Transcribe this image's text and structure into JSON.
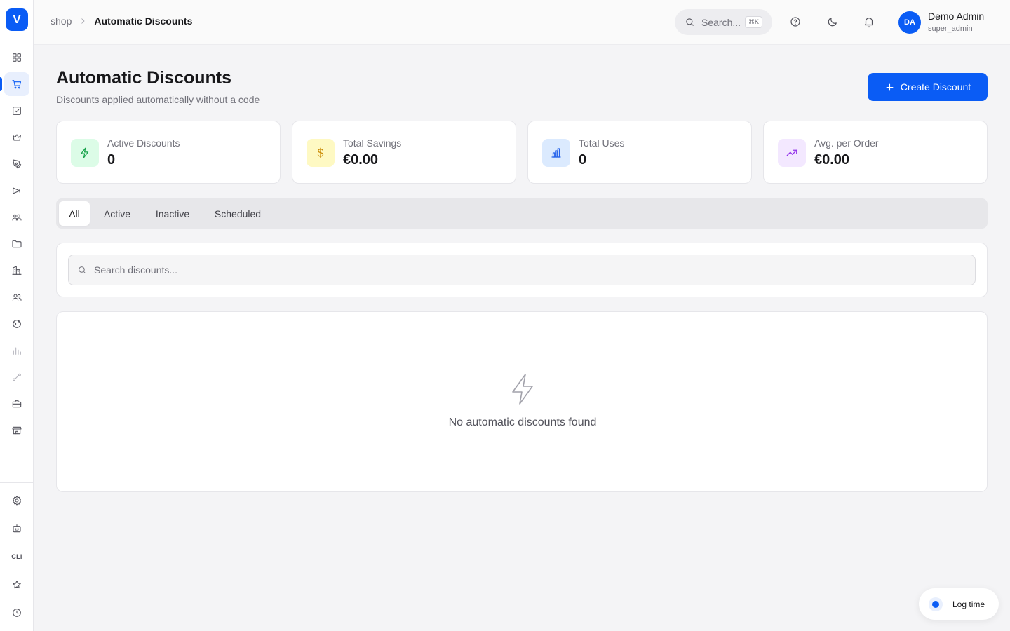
{
  "app": {
    "logo_letter": "V"
  },
  "breadcrumb": {
    "root": "shop",
    "current": "Automatic Discounts"
  },
  "header": {
    "search_placeholder": "Search...",
    "search_shortcut": "⌘K",
    "user_initials": "DA",
    "user_name": "Demo Admin",
    "user_role": "super_admin"
  },
  "sidebar": {
    "items": [
      {
        "icon": "dashboard-grid-icon",
        "active": false
      },
      {
        "icon": "shopping-cart-icon",
        "active": true
      },
      {
        "icon": "checkbox-icon",
        "active": false
      },
      {
        "icon": "crown-icon",
        "active": false
      },
      {
        "icon": "pen-tool-icon",
        "active": false
      },
      {
        "icon": "megaphone-icon",
        "active": false
      },
      {
        "icon": "users-group-icon",
        "active": false
      },
      {
        "icon": "folder-icon",
        "active": false
      },
      {
        "icon": "building-icon",
        "active": false
      },
      {
        "icon": "contacts-icon",
        "active": false
      },
      {
        "icon": "globe-icon",
        "active": false
      },
      {
        "icon": "bar-chart-icon",
        "active": false
      },
      {
        "icon": "route-icon",
        "active": false
      },
      {
        "icon": "briefcase-icon",
        "active": false
      },
      {
        "icon": "store-icon",
        "active": false
      }
    ],
    "bottom_items": [
      {
        "icon": "settings-icon"
      },
      {
        "icon": "robot-icon"
      },
      {
        "icon": "cli-icon",
        "label": "CLI"
      },
      {
        "icon": "star-icon"
      },
      {
        "icon": "clock-icon"
      }
    ]
  },
  "page": {
    "title": "Automatic Discounts",
    "subtitle": "Discounts applied automatically without a code",
    "create_button": "Create Discount"
  },
  "stats": [
    {
      "label": "Active Discounts",
      "value": "0",
      "icon": "lightning-icon",
      "color": "#16a34a",
      "bg": "#dcfce7"
    },
    {
      "label": "Total Savings",
      "value": "€0.00",
      "icon": "dollar-icon",
      "color": "#ca8a04",
      "bg": "#fef9c3"
    },
    {
      "label": "Total Uses",
      "value": "0",
      "icon": "bar-chart-icon",
      "color": "#2563eb",
      "bg": "#dbeafe"
    },
    {
      "label": "Avg. per Order",
      "value": "€0.00",
      "icon": "trending-up-icon",
      "color": "#9333ea",
      "bg": "#f3e8ff"
    }
  ],
  "tabs": [
    {
      "label": "All",
      "active": true
    },
    {
      "label": "Active",
      "active": false
    },
    {
      "label": "Inactive",
      "active": false
    },
    {
      "label": "Scheduled",
      "active": false
    }
  ],
  "search": {
    "placeholder": "Search discounts...",
    "value": ""
  },
  "empty_state": {
    "icon": "lightning-icon",
    "text": "No automatic discounts found"
  },
  "log_time": {
    "label": "Log time"
  }
}
